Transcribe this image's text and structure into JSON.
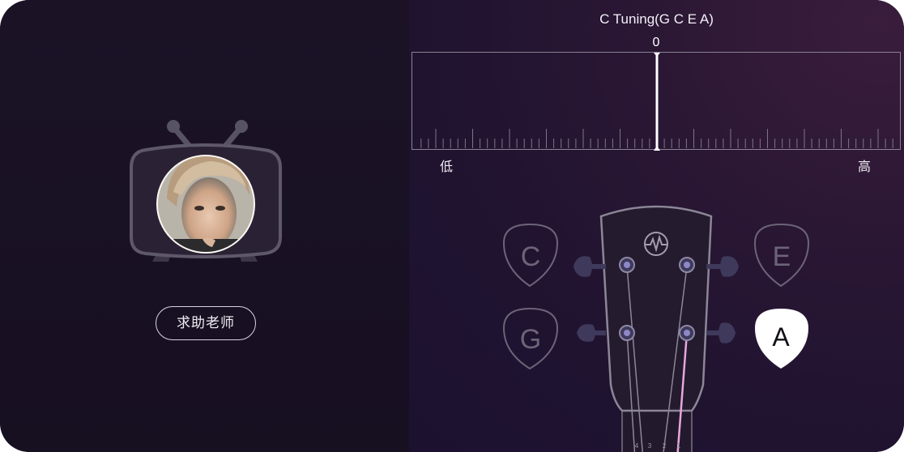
{
  "teacher": {
    "help_button_label": "求助老师",
    "avatar_icon": "teacher-avatar-photo",
    "tv_icon": "retro-tv-icon"
  },
  "tuner": {
    "title": "C Tuning(G C E A)",
    "meter_center_label": "0",
    "low_label": "低",
    "high_label": "高",
    "needle_offset": 0
  },
  "strings": {
    "picks": [
      {
        "note": "C",
        "active": false
      },
      {
        "note": "E",
        "active": false
      },
      {
        "note": "G",
        "active": false
      },
      {
        "note": "A",
        "active": true
      }
    ],
    "fret_numbers": [
      "4",
      "3",
      "2",
      "1"
    ],
    "logo_icon": "heartbeat-logo-icon"
  },
  "colors": {
    "active_string": "#e9a6e0",
    "inactive_pick": "#6c6478",
    "active_pick_bg": "#ffffff"
  }
}
